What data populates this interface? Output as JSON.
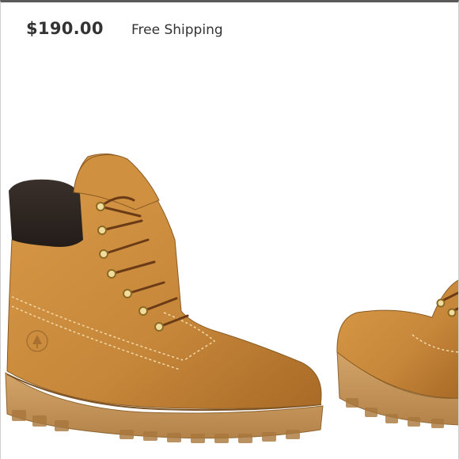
{
  "listing": {
    "price": "$190.00",
    "shipping": "Free Shipping"
  },
  "image": {
    "subject": "boot-photo",
    "colors": {
      "nubuck": "#c98a3b",
      "nubuck_shadow": "#9b6322",
      "collar": "#2e2622",
      "sole": "#c99a5f",
      "sole_dark": "#a97a42",
      "lace": "#6b3a16",
      "eyelet": "#c9a445"
    }
  }
}
